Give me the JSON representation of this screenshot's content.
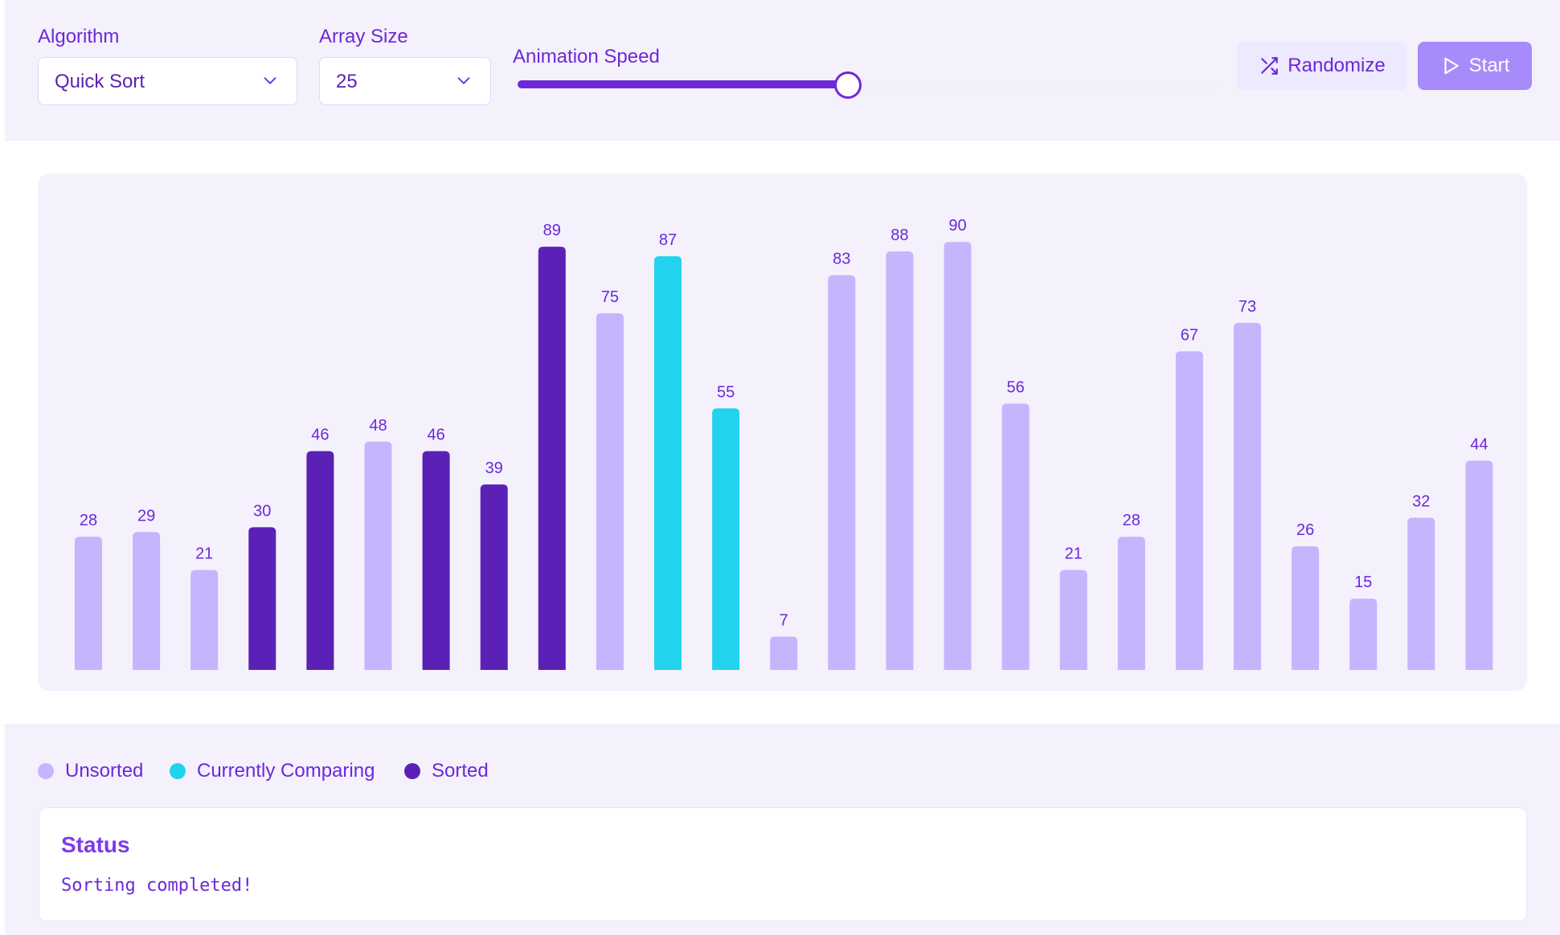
{
  "controls": {
    "algorithm_label": "Algorithm",
    "algorithm_value": "Quick Sort",
    "size_label": "Array Size",
    "size_value": "25",
    "speed_label": "Animation Speed",
    "speed_fraction": 0.47,
    "randomize_label": "Randomize",
    "start_label": "Start"
  },
  "colors": {
    "unsorted": "#c4b5fd",
    "comparing": "#22d3ee",
    "sorted": "#5b21b6",
    "accent": "#6d28d9",
    "panel_bg": "#f4f1fd"
  },
  "legend": {
    "unsorted_label": "Unsorted",
    "comparing_label": "Currently Comparing",
    "sorted_label": "Sorted"
  },
  "status": {
    "title": "Status",
    "message": "Sorting completed!"
  },
  "chart_data": {
    "type": "bar",
    "values": [
      28,
      29,
      21,
      30,
      46,
      48,
      46,
      39,
      89,
      75,
      87,
      55,
      7,
      83,
      88,
      90,
      56,
      21,
      28,
      67,
      73,
      26,
      15,
      32,
      44
    ],
    "states": [
      "unsorted",
      "unsorted",
      "unsorted",
      "sorted",
      "sorted",
      "unsorted",
      "sorted",
      "sorted",
      "sorted",
      "unsorted",
      "comparing",
      "comparing",
      "unsorted",
      "unsorted",
      "unsorted",
      "unsorted",
      "unsorted",
      "unsorted",
      "unsorted",
      "unsorted",
      "unsorted",
      "unsorted",
      "unsorted",
      "unsorted",
      "unsorted"
    ],
    "ylim": [
      0,
      100
    ],
    "grid": false
  }
}
